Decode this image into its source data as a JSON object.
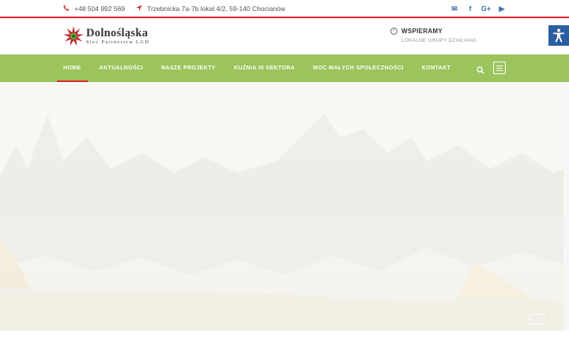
{
  "topbar": {
    "phone": "+48 504 992 569",
    "address": "Trzebnicka 7a-7b  lokal 4/2, 59-140 Chocianów",
    "phone_icon": "phone-icon",
    "location_icon": "location-arrow-icon",
    "social": [
      {
        "name": "email-icon",
        "glyph": "✉"
      },
      {
        "name": "facebook-icon",
        "glyph": "f"
      },
      {
        "name": "google-plus-icon",
        "glyph": "G+"
      },
      {
        "name": "youtube-icon",
        "glyph": "▶"
      }
    ]
  },
  "header": {
    "logo_title": "Dolnośląska",
    "logo_subtitle": "Sieć Partnerstw LGD",
    "support_title": "WSPIERAMY",
    "support_sub": "LOKALNE GRUPY DZIAŁANIA"
  },
  "nav": {
    "items": [
      "HOME",
      "AKTUALNOŚCI",
      "NASZE PROJEKTY",
      "KUŹNIA III SEKTORA",
      "MOC MAŁYCH SPOŁECZNOŚCI",
      "KONTAKT"
    ],
    "active_index": 0
  },
  "colors": {
    "accent_red": "#d9262f",
    "nav_green": "#9bc45c",
    "social_blue": "#3a6ea5",
    "a11y_blue": "#2b5ea0"
  }
}
